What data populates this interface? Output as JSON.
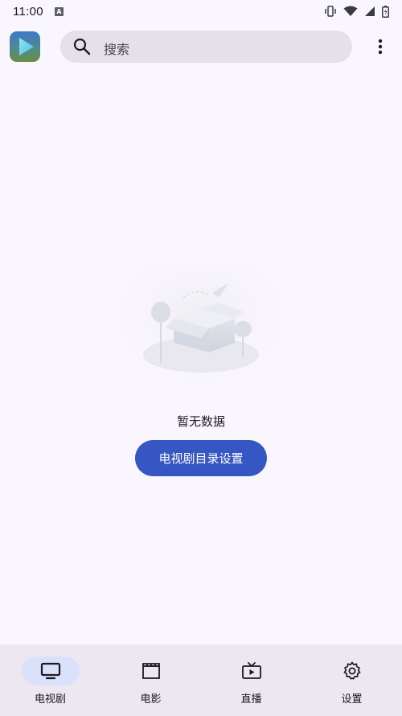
{
  "status_bar": {
    "time": "11:00",
    "a_badge": "A"
  },
  "search": {
    "placeholder": "搜索"
  },
  "empty_state": {
    "message": "暂无数据",
    "button_label": "电视剧目录设置"
  },
  "bottom_nav": {
    "items": [
      {
        "label": "电视剧",
        "icon": "tv-icon",
        "active": true
      },
      {
        "label": "电影",
        "icon": "clapperboard-icon",
        "active": false
      },
      {
        "label": "直播",
        "icon": "live-tv-icon",
        "active": false
      },
      {
        "label": "设置",
        "icon": "gear-icon",
        "active": false
      }
    ]
  },
  "colors": {
    "background": "#f9f6fd",
    "accent": "#3656c4",
    "nav_background": "#ece7f0",
    "nav_active_pill": "#dae1fb",
    "search_background": "#e6e1e9"
  }
}
